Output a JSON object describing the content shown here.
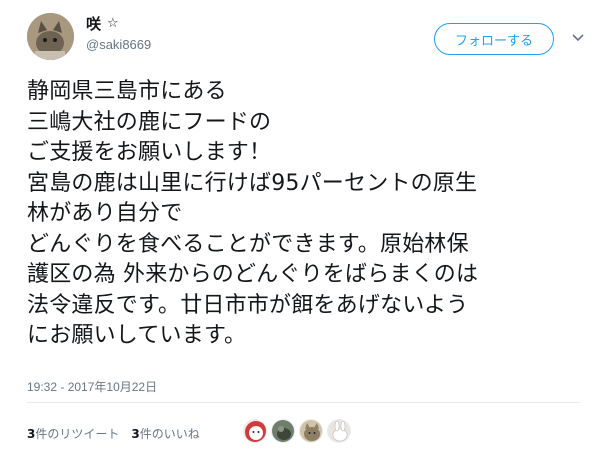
{
  "user": {
    "display_name": "咲",
    "badge": "☆",
    "handle": "@saki8669"
  },
  "follow_button": {
    "label": "フォローする"
  },
  "tweet": {
    "lines": [
      "静岡県三島市にある",
      "三嶋大社の鹿にフードの",
      "ご支援をお願いします！",
      "宮島の鹿は山里に行けば95パーセントの原生",
      "林があり自分で",
      "どんぐりを食べることができます。原始林保",
      "護区の為 外来からのどんぐりをばらまくのは",
      "法令違反です。廿日市市が餌をあげないよう",
      "にお願いしています。"
    ],
    "timestamp": "19:32 - 2017年10月22日"
  },
  "stats": {
    "retweet_count": "3",
    "retweet_label": "件のリツイート",
    "like_count": "3",
    "like_label": "件のいいね"
  },
  "liker_icons": [
    "cat-avatar",
    "animal-avatar",
    "cat-avatar",
    "bunny-avatar"
  ],
  "colors": {
    "accent": "#1da1f2",
    "text": "#14171a",
    "muted": "#657786"
  }
}
